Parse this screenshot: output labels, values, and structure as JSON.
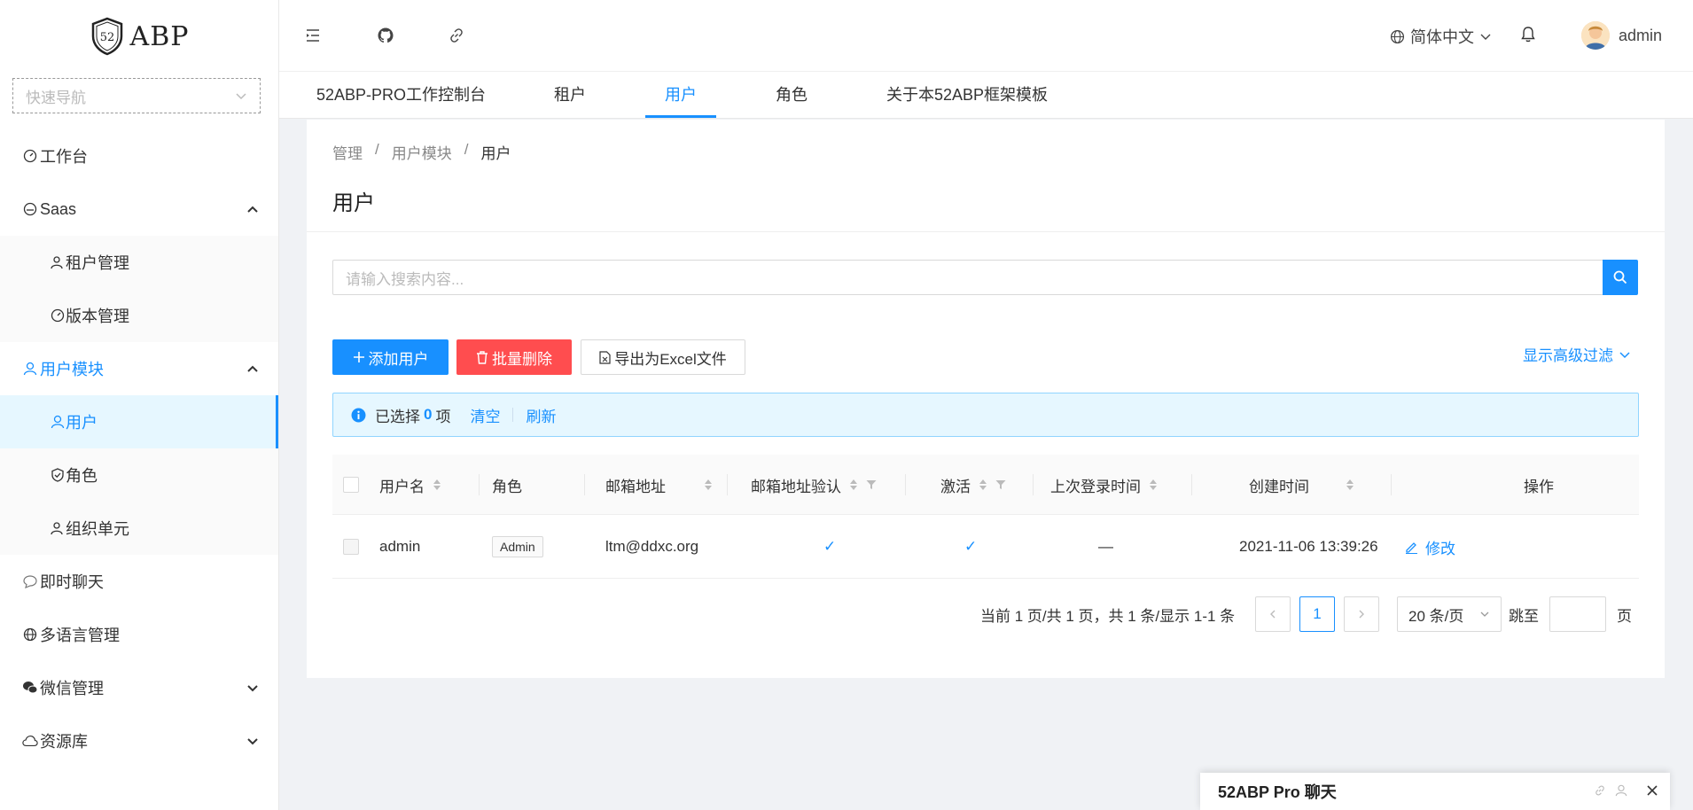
{
  "sidebar": {
    "logo_text": "ABP",
    "logo_badge": "52",
    "quicknav_placeholder": "快速导航",
    "items": [
      {
        "label": "工作台"
      },
      {
        "label": "Saas"
      },
      {
        "label": "租户管理"
      },
      {
        "label": "版本管理"
      },
      {
        "label": "用户模块"
      },
      {
        "label": "用户"
      },
      {
        "label": "角色"
      },
      {
        "label": "组织单元"
      },
      {
        "label": "即时聊天"
      },
      {
        "label": "多语言管理"
      },
      {
        "label": "微信管理"
      },
      {
        "label": "资源库"
      }
    ]
  },
  "header": {
    "language": "简体中文",
    "username": "admin"
  },
  "tabs": [
    {
      "label": "52ABP-PRO工作控制台"
    },
    {
      "label": "租户"
    },
    {
      "label": "用户"
    },
    {
      "label": "角色"
    },
    {
      "label": "关于本52ABP框架模板"
    }
  ],
  "breadcrumb": [
    "管理",
    "用户模块",
    "用户"
  ],
  "page_title": "用户",
  "search": {
    "placeholder": "请输入搜索内容..."
  },
  "toolbar": {
    "add_label": "添加用户",
    "batch_delete_label": "批量删除",
    "export_label": "导出为Excel文件",
    "advanced_filter_label": "显示高级过滤"
  },
  "selection": {
    "prefix": "已选择",
    "count": "0",
    "suffix": "项",
    "clear_label": "清空",
    "refresh_label": "刷新"
  },
  "table": {
    "columns": [
      "用户名",
      "角色",
      "邮箱地址",
      "邮箱地址验认",
      "激活",
      "上次登录时间",
      "创建时间",
      "操作"
    ],
    "rows": [
      {
        "username": "admin",
        "role": "Admin",
        "email": "ltm@ddxc.org",
        "email_confirmed": "✓",
        "active": "✓",
        "last_login": "—",
        "created": "2021-11-06 13:39:26",
        "action": "修改"
      }
    ]
  },
  "pagination": {
    "summary": "当前 1 页/共 1 页，共 1 条/显示 1-1 条",
    "current_page": "1",
    "page_size": "20 条/页",
    "jump_label": "跳至",
    "page_suffix": "页"
  },
  "chat": {
    "title": "52ABP Pro 聊天"
  },
  "colors": {
    "primary": "#1890ff",
    "danger": "#ff4d4f"
  }
}
